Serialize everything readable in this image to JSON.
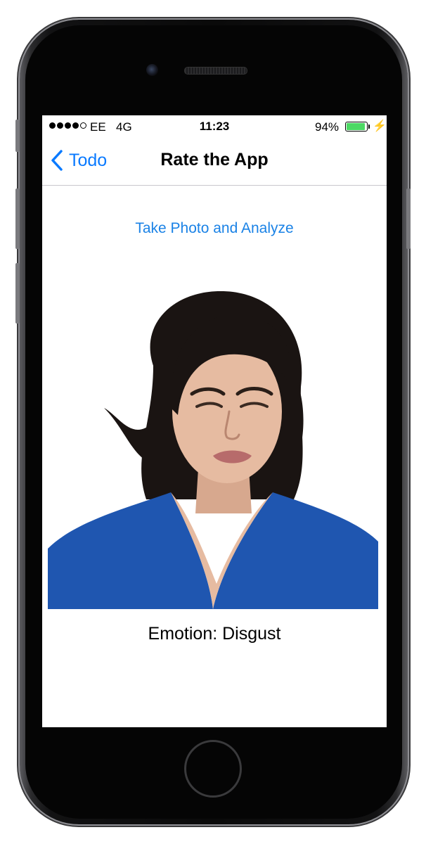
{
  "status_bar": {
    "carrier": "EE",
    "network": "4G",
    "time": "11:23",
    "battery_percent": "94%",
    "battery_level": 0.94,
    "signal_bars": 4,
    "signal_max": 5
  },
  "nav": {
    "back_label": "Todo",
    "title": "Rate the App"
  },
  "main": {
    "action_label": "Take Photo and Analyze",
    "result_text": "Emotion: Disgust"
  },
  "colors": {
    "accent": "#0a7aff",
    "battery": "#4cd964",
    "shirt": "#1f56b0"
  },
  "icons": {
    "back": "chevron-left-icon",
    "charging": "lightning-bolt-icon"
  }
}
